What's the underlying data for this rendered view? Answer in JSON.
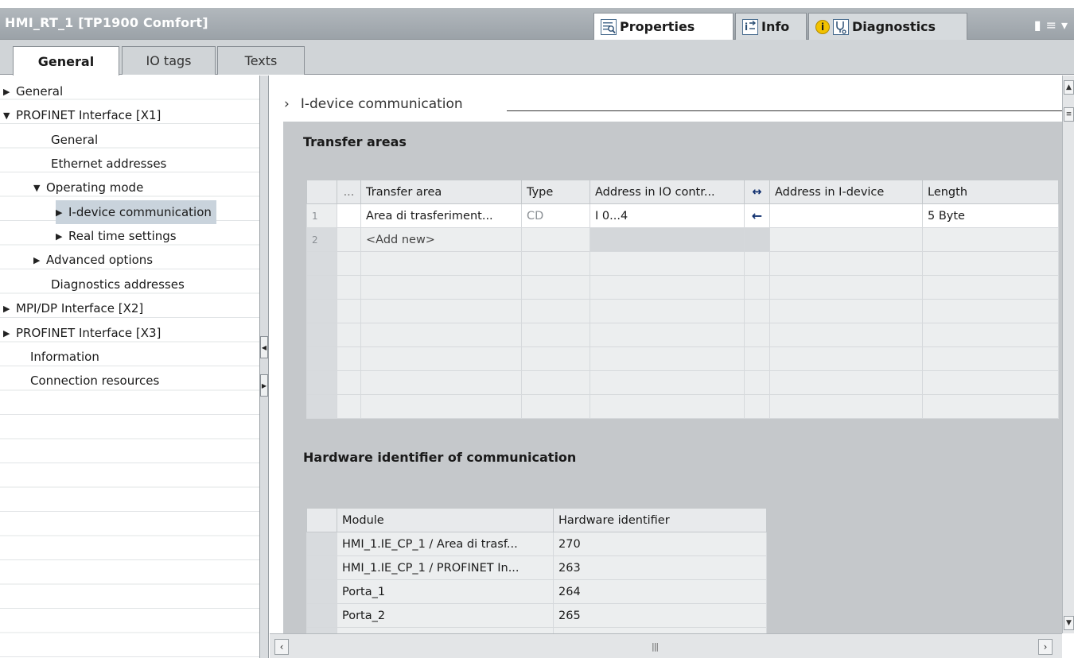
{
  "window": {
    "title": "HMI_RT_1 [TP1900 Comfort]"
  },
  "panel_tabs": {
    "properties": "Properties",
    "info": "Info",
    "info_badge": "i",
    "diagnostics": "Diagnostics"
  },
  "sub_tabs": [
    "General",
    "IO tags",
    "Texts"
  ],
  "tree": {
    "items": [
      "General",
      "PROFINET Interface [X1]",
      "General",
      "Ethernet addresses",
      "Operating mode",
      "I-device communication",
      "Real time settings",
      "Advanced options",
      "Diagnostics addresses",
      "MPI/DP Interface [X2]",
      "PROFINET Interface [X3]",
      "Information",
      "Connection resources"
    ],
    "selected": "I-device communication"
  },
  "section": {
    "title": "I-device communication"
  },
  "transfer_areas": {
    "heading": "Transfer areas",
    "columns": [
      "",
      "...",
      "Transfer area",
      "Type",
      "Address in IO contr...",
      "↔",
      "Address in I-device",
      "Length"
    ],
    "rows": [
      {
        "num": "1",
        "name": "Area di trasferiment...",
        "type": "CD",
        "io_address": "I 0...4",
        "direction": "←",
        "idevice_address": "",
        "length": "5 Byte"
      },
      {
        "num": "2",
        "name": "<Add new>",
        "type": "",
        "io_address": "",
        "direction": "",
        "idevice_address": "",
        "length": ""
      }
    ]
  },
  "hardware": {
    "heading": "Hardware identifier of communication",
    "columns": [
      "Module",
      "Hardware identifier"
    ],
    "rows": [
      {
        "module": "HMI_1.IE_CP_1 / Area di trasf...",
        "id": "270"
      },
      {
        "module": "HMI_1.IE_CP_1 / PROFINET In...",
        "id": "263"
      },
      {
        "module": "Porta_1",
        "id": "264"
      },
      {
        "module": "Porta_2",
        "id": "265"
      }
    ]
  },
  "colors": {
    "title_bar": "#a5acb2",
    "selection": "#c9d3dc",
    "content_gray": "#c5c8cb",
    "arrow": "#0e2e6e",
    "info_badge": "#f2c200"
  }
}
